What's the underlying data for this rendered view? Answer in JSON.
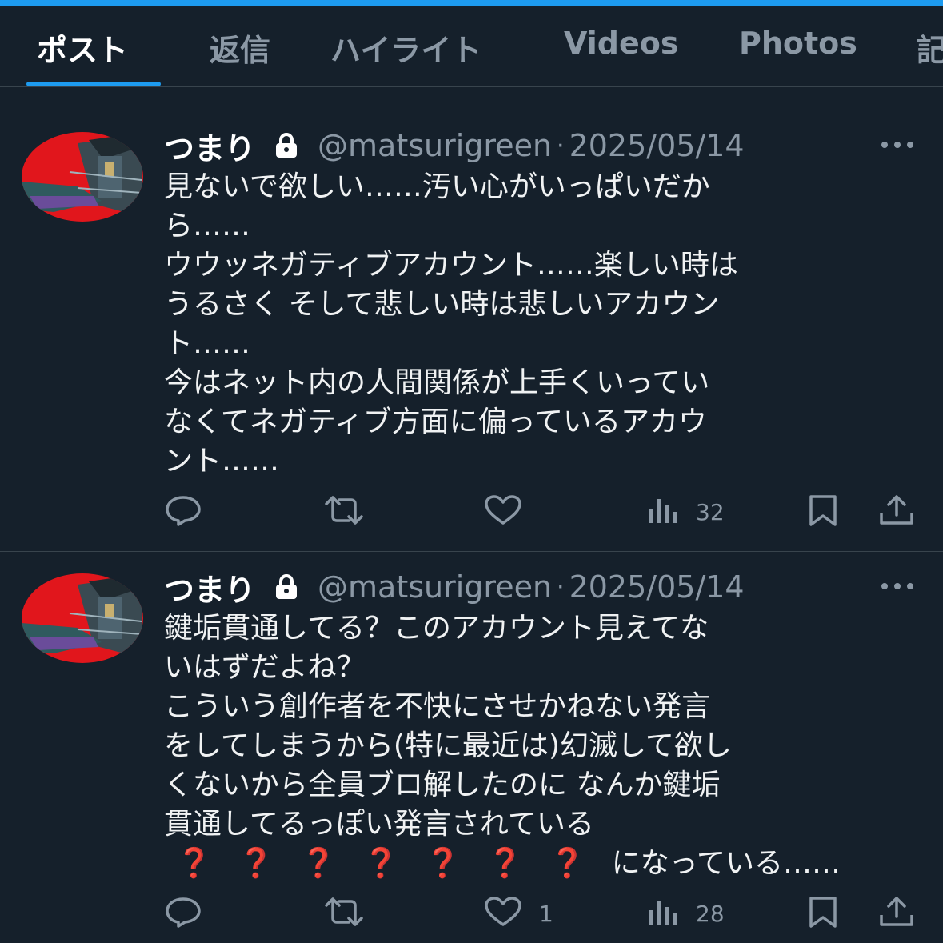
{
  "tabs": [
    {
      "label": "ポスト",
      "active": true
    },
    {
      "label": "返信"
    },
    {
      "label": "ハイライト"
    },
    {
      "label": "Videos"
    },
    {
      "label": "Photos"
    },
    {
      "label": "記"
    }
  ],
  "posts": [
    {
      "name": "つまり",
      "handle": "@matsurigreen",
      "separator": "·",
      "date": "2025/05/14",
      "lines": [
        "見ないで欲しい……汚い心がいっぱいだか",
        "ら……",
        "ウウッネガティブアカウント……楽しい時は",
        "うるさく そして悲しい時は悲しいアカウン",
        "ト……",
        "今はネット内の人間関係が上手くいってい",
        "なくてネガティブ方面に偏っているアカウ",
        "ント……"
      ],
      "likes": "",
      "views": "32"
    },
    {
      "name": "つまり",
      "handle": "@matsurigreen",
      "separator": "·",
      "date": "2025/05/14",
      "lines": [
        "鍵垢貫通してる？このアカウント見えてな",
        "いはずだよね？",
        "こういう創作者を不快にさせかねない発言",
        "をしてしまうから(特に最近は)幻滅して欲し",
        "くないから全員ブロ解したのに なんか鍵垢",
        "貫通してるっぽい発言されている"
      ],
      "emoji_line": {
        "marks": [
          "❓",
          "❓",
          "❓",
          "❓",
          "❓",
          "❓",
          "❓"
        ],
        "text": "になっている……"
      },
      "likes": "1",
      "views": "28"
    }
  ],
  "colors": {
    "accent": "#1d9bf0",
    "background": "#15202b",
    "muted": "#8b98a5",
    "divider": "#38444d"
  },
  "icons": [
    "lock-icon",
    "more-icon",
    "reply-icon",
    "retweet-icon",
    "like-icon",
    "views-icon",
    "bookmark-icon",
    "share-icon"
  ]
}
